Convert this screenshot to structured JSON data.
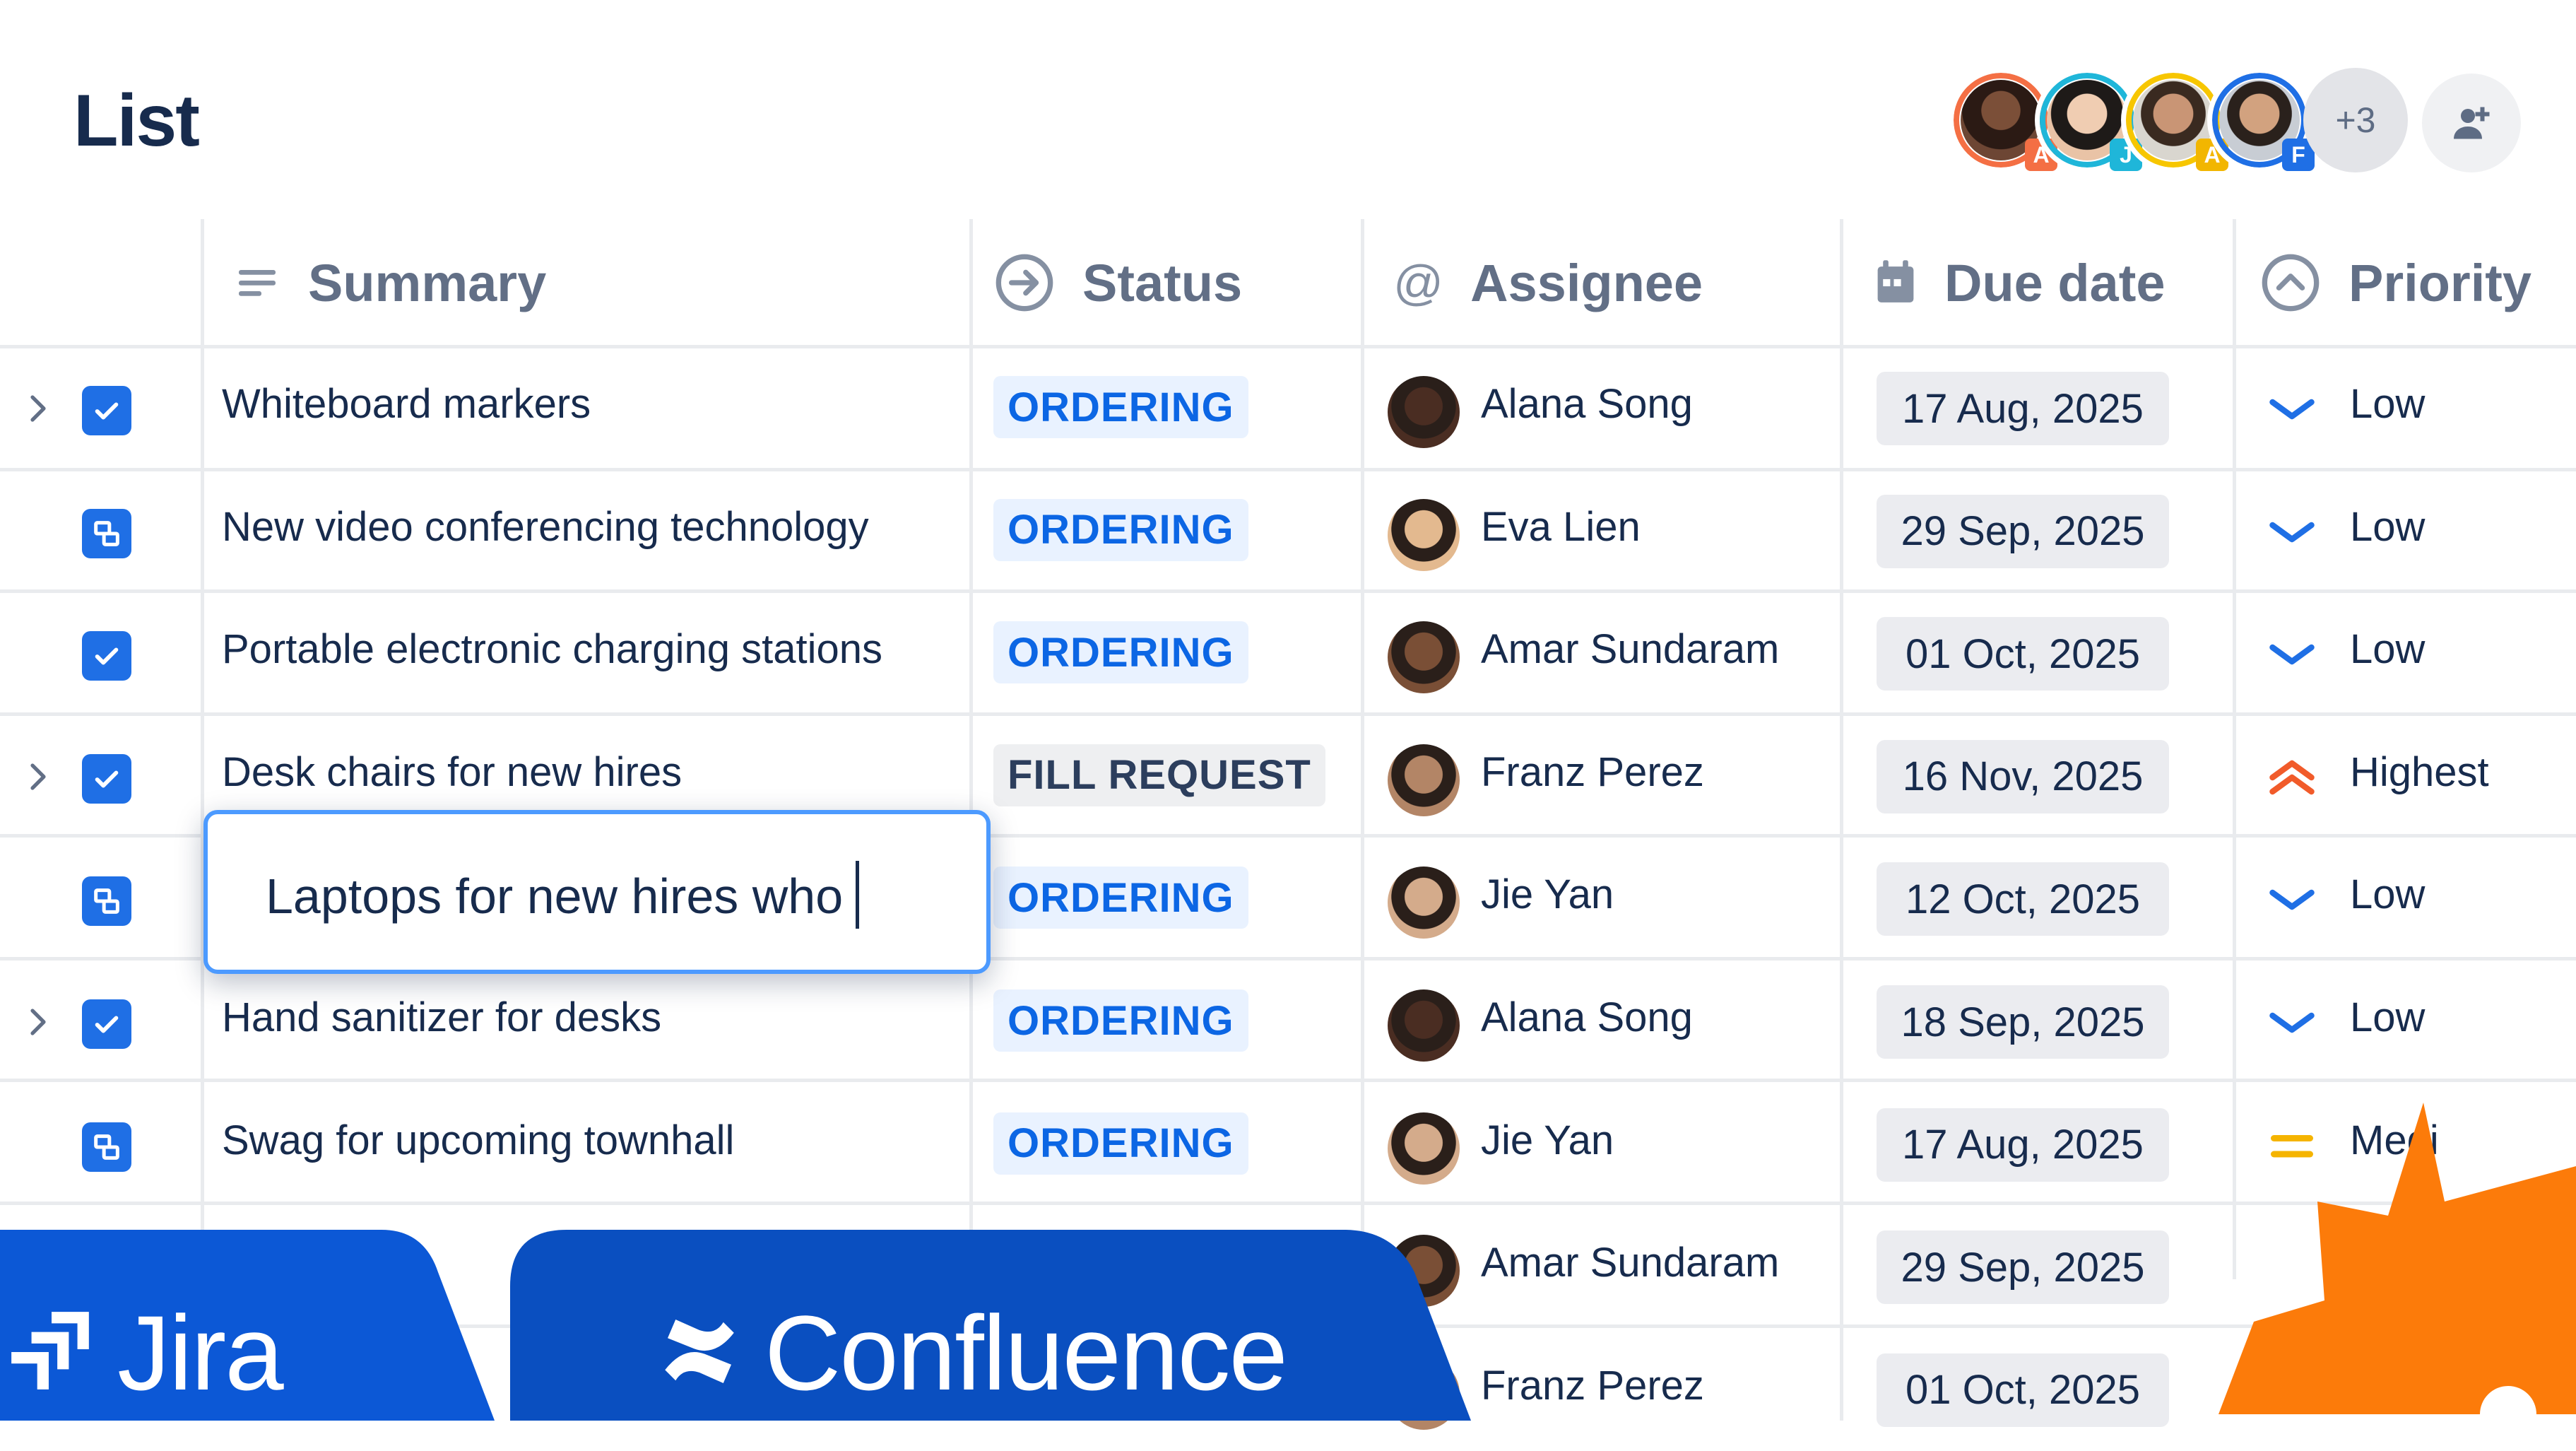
{
  "page": {
    "title": "List"
  },
  "collaborators": {
    "avatars": [
      {
        "initial": "A",
        "ring_color": "#f46f44",
        "tag_color": "#f46f44",
        "face_color": "#5a3a2b"
      },
      {
        "initial": "J",
        "ring_color": "#1fb6d9",
        "tag_color": "#1fb6d9",
        "face_color": "#d9b396"
      },
      {
        "initial": "A",
        "ring_color": "#f7c600",
        "tag_color": "#f2b600",
        "face_color": "#8a5b42"
      },
      {
        "initial": "F",
        "ring_color": "#1f6fe5",
        "tag_color": "#1f6fe5",
        "face_color": "#b78a6c"
      }
    ],
    "more_label": "+3"
  },
  "columns": {
    "summary": "Summary",
    "status": "Status",
    "assignee": "Assignee",
    "due_date": "Due date",
    "priority": "Priority"
  },
  "rows": [
    {
      "expandable": true,
      "type": "checkbox",
      "summary": "Whiteboard markers",
      "status": "ORDERING",
      "status_kind": "ordering",
      "assignee": "Alana Song",
      "assignee_color": "#4a2d22",
      "due": "17 Aug, 2025",
      "priority": "Low",
      "priority_kind": "low"
    },
    {
      "expandable": false,
      "type": "subtask",
      "summary": "New video conferencing technology",
      "status": "ORDERING",
      "status_kind": "ordering",
      "assignee": "Eva Lien",
      "assignee_color": "#e3b98f",
      "due": "29 Sep, 2025",
      "priority": "Low",
      "priority_kind": "low"
    },
    {
      "expandable": false,
      "type": "checkbox",
      "summary": "Portable electronic charging stations",
      "status": "ORDERING",
      "status_kind": "ordering",
      "assignee": "Amar Sundaram",
      "assignee_color": "#7a4f36",
      "due": "01 Oct, 2025",
      "priority": "Low",
      "priority_kind": "low"
    },
    {
      "expandable": true,
      "type": "checkbox",
      "summary": "Desk chairs for new hires",
      "status": "FILL REQUEST",
      "status_kind": "fill",
      "assignee": "Franz Perez",
      "assignee_color": "#b38566",
      "due": "16 Nov, 2025",
      "priority": "Highest",
      "priority_kind": "highest"
    },
    {
      "expandable": false,
      "type": "subtask",
      "summary": "",
      "status": "ORDERING",
      "status_kind": "ordering",
      "assignee": "Jie Yan",
      "assignee_color": "#d4ab8b",
      "due": "12 Oct, 2025",
      "priority": "Low",
      "priority_kind": "low"
    },
    {
      "expandable": true,
      "type": "checkbox",
      "summary": "Hand sanitizer for desks",
      "status": "ORDERING",
      "status_kind": "ordering",
      "assignee": "Alana Song",
      "assignee_color": "#4a2d22",
      "due": "18 Sep, 2025",
      "priority": "Low",
      "priority_kind": "low"
    },
    {
      "expandable": false,
      "type": "subtask",
      "summary": "Swag for upcoming townhall",
      "status": "ORDERING",
      "status_kind": "ordering",
      "assignee": "Jie Yan",
      "assignee_color": "#d4ab8b",
      "due": "17 Aug, 2025",
      "priority": "Medi",
      "priority_kind": "medium"
    },
    {
      "expandable": false,
      "type": "none",
      "summary": "",
      "status": "",
      "status_kind": "none",
      "assignee": "Amar Sundaram",
      "assignee_color": "#7a4f36",
      "due": "29 Sep, 2025",
      "priority": "",
      "priority_kind": "none"
    },
    {
      "expandable": false,
      "type": "none",
      "summary": "",
      "status": "",
      "status_kind": "none",
      "assignee": "Franz Perez",
      "assignee_color": "#b38566",
      "due": "01 Oct, 2025",
      "priority": "",
      "priority_kind": "none"
    }
  ],
  "inline_editor": {
    "value": "Laptops for new hires who"
  },
  "branding": {
    "jira": "Jira",
    "confluence": "Confluence",
    "accent": "#0c58d6",
    "accent_dark": "#0a4fc0",
    "burst_color": "#fc7b0a"
  }
}
